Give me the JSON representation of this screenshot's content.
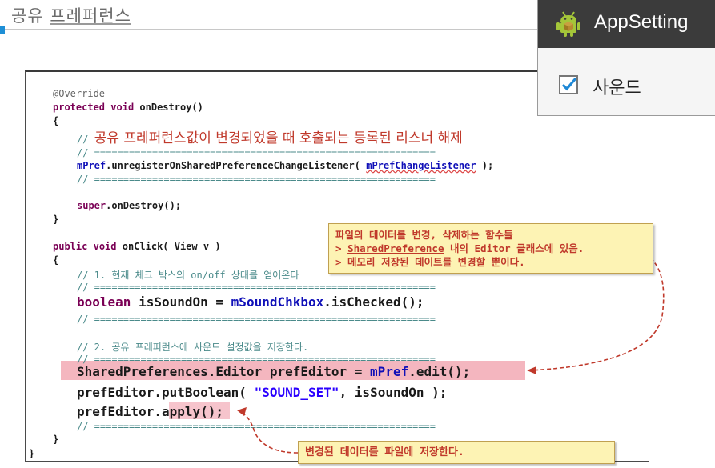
{
  "slide": {
    "title_prefix": "공유 ",
    "title_underlined": "프레퍼런스"
  },
  "app": {
    "title": "AppSetting",
    "checkbox_label": "사운드",
    "checkbox_checked": true,
    "bar_color": "#3b3b3b",
    "android_green": "#a4c639"
  },
  "code": {
    "l1": "@Override",
    "l2_kw1": "protected",
    "l2_kw2": "void",
    "l2_rest": " onDestroy()",
    "l3": "{",
    "l4_slash": "// ",
    "l4_comment": "공유 프레퍼런스값이 변경되었을 때 호출되는 등록된 리스너 해제",
    "sep": "// ===========================================================",
    "l6_a": "mPref",
    "l6_b": ".unregisterOnSharedPreferenceChangeListener( ",
    "l6_c": "mPrefChangeListener",
    "l6_d": " );",
    "l8_kw": "super",
    "l8_rest": ".onDestroy();",
    "l9": "}",
    "l10_kw1": "public",
    "l10_kw2": "void",
    "l10_rest": " onClick( View v )",
    "l11": "{",
    "l12": "// 1. 현재 체크 박스의 on/off 상태를 얻어온다",
    "l14_kw": "boolean",
    "l14_a": " isSoundOn = ",
    "l14_b": "mSoundChkbox",
    "l14_c": ".isChecked();",
    "l16": "// 2. 공유 프레퍼런스에 사운드 설정값을 저장한다.",
    "l18_a": "SharedPreferences.Editor prefEditor = ",
    "l18_b": "mPref",
    "l18_c": ".edit();",
    "l19_a": "prefEditor.putBoolean( ",
    "l19_b": "\"SOUND_SET\"",
    "l19_c": ", isSoundOn );",
    "l20": "prefEditor.apply();",
    "l22": "}",
    "l23": "}"
  },
  "note1": {
    "line1": "파일의 데이터를 변경, 삭제하는 함수들",
    "line2_a": "> ",
    "line2_b": "SharedPreference",
    "line2_c": " 내의 Editor 클래스에 있음.",
    "line3": "> 메모리 저장된 데이트를 변경할 뿐이다."
  },
  "note2": {
    "text": "변경된 데이터를 파일에 저장한다."
  }
}
